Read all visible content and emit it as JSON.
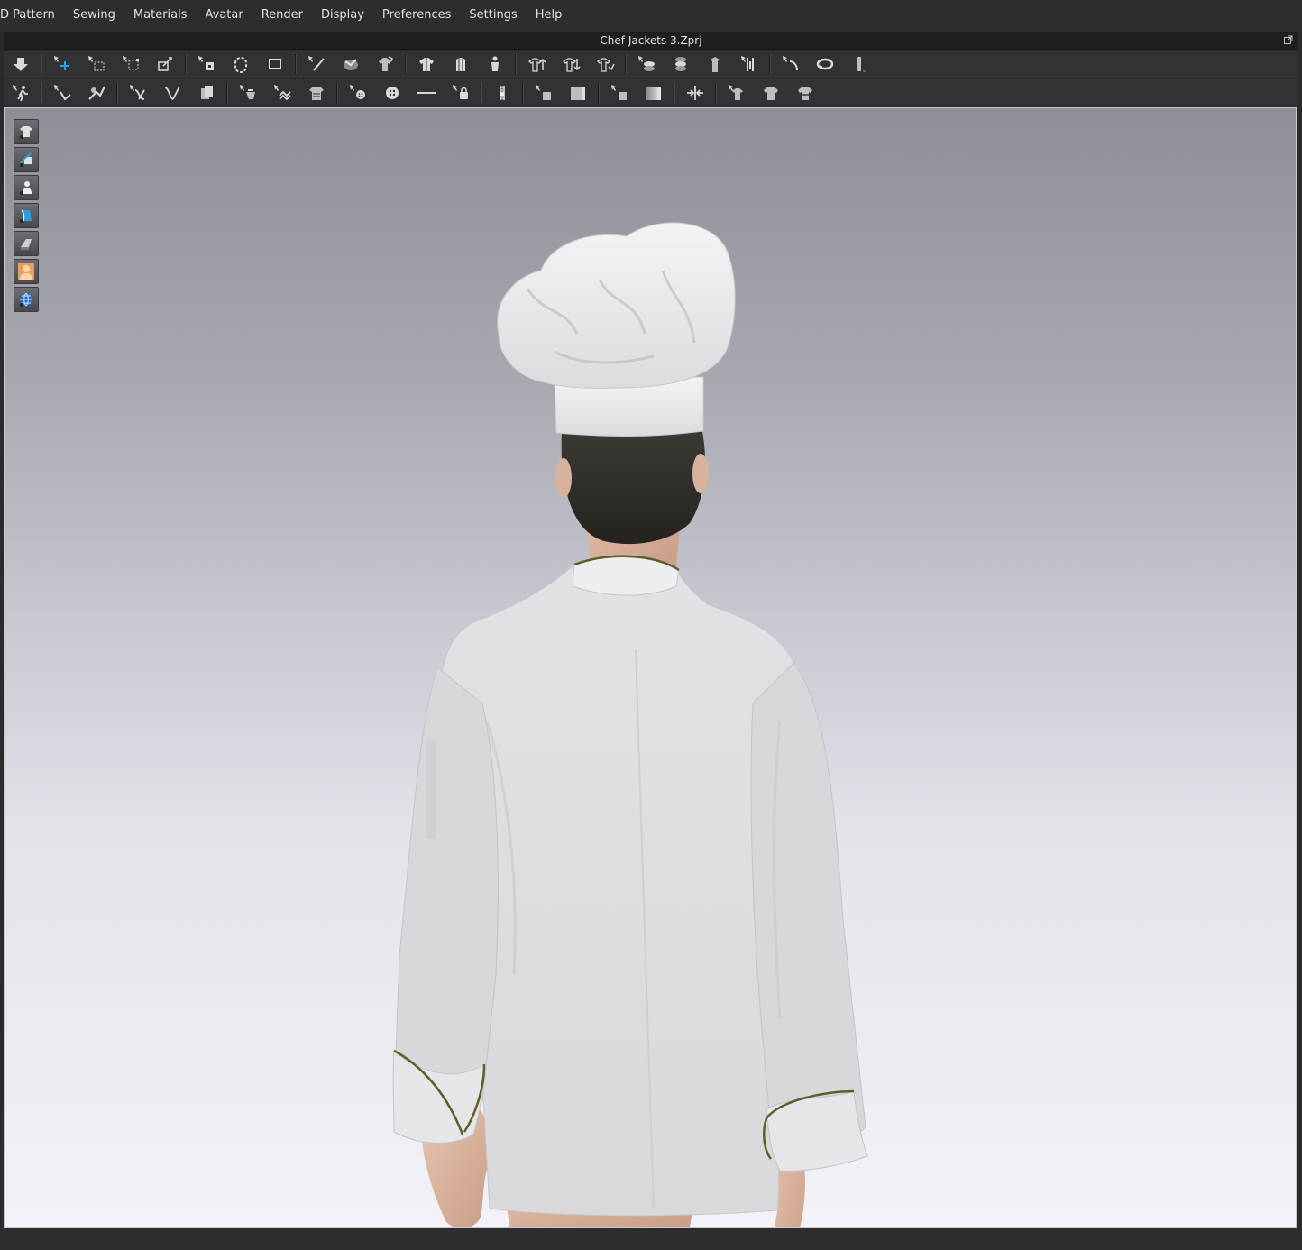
{
  "menubar": {
    "items": [
      "D Pattern",
      "Sewing",
      "Materials",
      "Avatar",
      "Render",
      "Display",
      "Preferences",
      "Settings",
      "Help"
    ]
  },
  "window": {
    "title": "Chef Jackets 3.Zprj"
  },
  "colors": {
    "accent": "#1ea7e1",
    "piping": "#5b5f2a",
    "cloth": "#e6e6e8"
  },
  "toolbar_row1": [
    "fold-down-icon",
    "select-move-icon",
    "box-select-icon",
    "transform-icon",
    "pin-icon",
    "arrange-icon",
    "rearrange-icon",
    "orbit-icon",
    "needle-icon",
    "tack-icon",
    "fold-garment-icon",
    "garment-front-icon",
    "garment-back-icon",
    "garment-side-icon",
    "lift-icon",
    "lower-icon",
    "arrange-points-icon",
    "layer-up-icon",
    "layer-down-icon",
    "measure-avatar-icon",
    "measure-width-icon",
    "tape-icon",
    "ruler-icon"
  ],
  "toolbar_row2": [
    "walk-avatar-icon",
    "strain-icon",
    "pressure-icon",
    "line-tool-icon",
    "line-check-icon",
    "copy-icon",
    "fit-icon",
    "puckering-icon",
    "shirring-icon",
    "button-icon",
    "buttonhole-icon",
    "line-icon",
    "lock-icon",
    "zipper-icon",
    "texture-small-icon",
    "texture-large-icon",
    "surface-icon",
    "gradient-icon",
    "fit-arrows-icon",
    "shirt-hanger-icon",
    "shirt-icon",
    "shirt-flip-icon"
  ],
  "side_tools": [
    "garment-display-icon",
    "garment-texture-icon",
    "avatar-display-icon",
    "fabric-display-icon",
    "surface-icon",
    "avatar-skin-icon",
    "globe-icon"
  ]
}
